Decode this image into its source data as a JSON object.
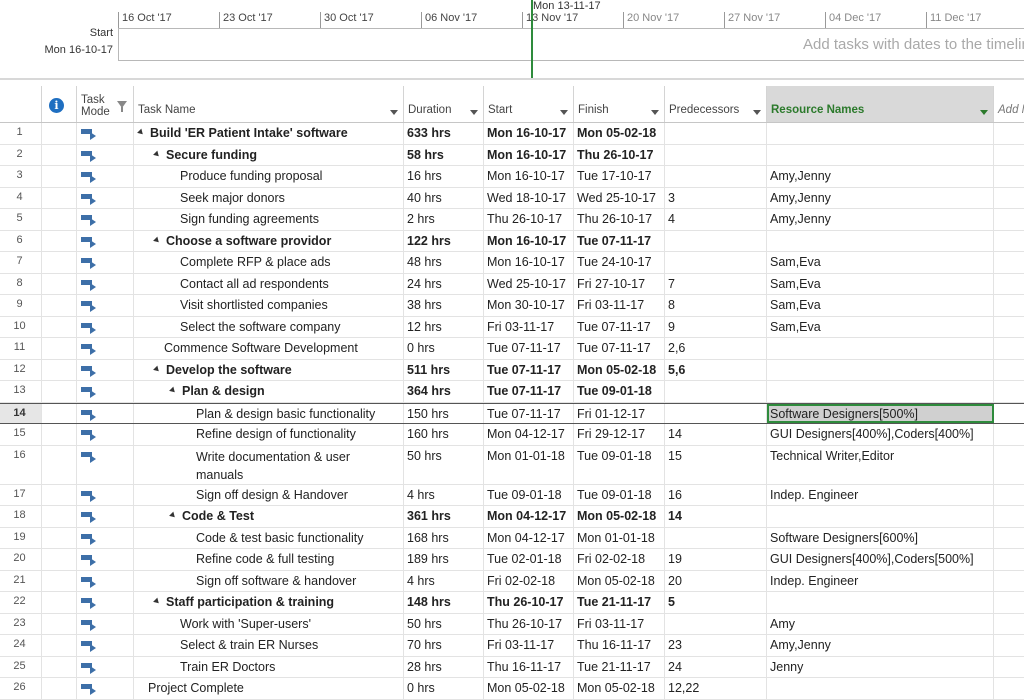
{
  "timeline": {
    "start_label": "Start",
    "start_date": "Mon 16-10-17",
    "today_label": "Mon 13-11-17",
    "hint": "Add tasks with dates to the timeline",
    "ticks": [
      "16 Oct '17",
      "23 Oct '17",
      "30 Oct '17",
      "06 Nov '17",
      "13 Nov '17",
      "20 Nov '17",
      "27 Nov '17",
      "04 Dec '17",
      "11 Dec '17"
    ]
  },
  "columns": {
    "mode": "Task Mode",
    "name": "Task Name",
    "duration": "Duration",
    "start": "Start",
    "finish": "Finish",
    "predecessors": "Predecessors",
    "resources": "Resource Names",
    "add": "Add New Column"
  },
  "rows": [
    {
      "id": "1",
      "name": "Build 'ER Patient Intake' software",
      "dur": "633 hrs",
      "start": "Mon 16-10-17",
      "finish": "Mon 05-02-18",
      "pred": "",
      "res": "",
      "summary": true,
      "level": 0
    },
    {
      "id": "2",
      "name": "Secure funding",
      "dur": "58 hrs",
      "start": "Mon 16-10-17",
      "finish": "Thu 26-10-17",
      "pred": "",
      "res": "",
      "summary": true,
      "level": 1
    },
    {
      "id": "3",
      "name": "Produce funding proposal",
      "dur": "16 hrs",
      "start": "Mon 16-10-17",
      "finish": "Tue 17-10-17",
      "pred": "",
      "res": "Amy,Jenny",
      "summary": false,
      "level": 2
    },
    {
      "id": "4",
      "name": "Seek major donors",
      "dur": "40 hrs",
      "start": "Wed 18-10-17",
      "finish": "Wed 25-10-17",
      "pred": "3",
      "res": "Amy,Jenny",
      "summary": false,
      "level": 2
    },
    {
      "id": "5",
      "name": "Sign funding agreements",
      "dur": "2 hrs",
      "start": "Thu 26-10-17",
      "finish": "Thu 26-10-17",
      "pred": "4",
      "res": "Amy,Jenny",
      "summary": false,
      "level": 2
    },
    {
      "id": "6",
      "name": "Choose a software providor",
      "dur": "122 hrs",
      "start": "Mon 16-10-17",
      "finish": "Tue 07-11-17",
      "pred": "",
      "res": "",
      "summary": true,
      "level": 1
    },
    {
      "id": "7",
      "name": "Complete RFP & place ads",
      "dur": "48 hrs",
      "start": "Mon 16-10-17",
      "finish": "Tue 24-10-17",
      "pred": "",
      "res": "Sam,Eva",
      "summary": false,
      "level": 2
    },
    {
      "id": "8",
      "name": "Contact all ad respondents",
      "dur": "24 hrs",
      "start": "Wed 25-10-17",
      "finish": "Fri 27-10-17",
      "pred": "7",
      "res": "Sam,Eva",
      "summary": false,
      "level": 2
    },
    {
      "id": "9",
      "name": "Visit shortlisted companies",
      "dur": "38 hrs",
      "start": "Mon 30-10-17",
      "finish": "Fri 03-11-17",
      "pred": "8",
      "res": "Sam,Eva",
      "summary": false,
      "level": 2
    },
    {
      "id": "10",
      "name": "Select the software company",
      "dur": "12 hrs",
      "start": "Fri 03-11-17",
      "finish": "Tue 07-11-17",
      "pred": "9",
      "res": "Sam,Eva",
      "summary": false,
      "level": 2
    },
    {
      "id": "11",
      "name": "Commence Software Development",
      "dur": "0 hrs",
      "start": "Tue 07-11-17",
      "finish": "Tue 07-11-17",
      "pred": "2,6",
      "res": "",
      "summary": false,
      "level": 1
    },
    {
      "id": "12",
      "name": "Develop the software",
      "dur": "511 hrs",
      "start": "Tue 07-11-17",
      "finish": "Mon 05-02-18",
      "pred": "5,6",
      "res": "",
      "summary": true,
      "level": 1
    },
    {
      "id": "13",
      "name": "Plan & design",
      "dur": "364 hrs",
      "start": "Tue 07-11-17",
      "finish": "Tue 09-01-18",
      "pred": "",
      "res": "",
      "summary": true,
      "level": 2
    },
    {
      "id": "14",
      "name": "Plan & design basic functionality",
      "dur": "150 hrs",
      "start": "Tue 07-11-17",
      "finish": "Fri 01-12-17",
      "pred": "",
      "res": "Software Designers[500%]",
      "summary": false,
      "level": 3,
      "selected": true
    },
    {
      "id": "15",
      "name": "Refine design of functionality",
      "dur": "160 hrs",
      "start": "Mon 04-12-17",
      "finish": "Fri 29-12-17",
      "pred": "14",
      "res": "GUI Designers[400%],Coders[400%]",
      "summary": false,
      "level": 3
    },
    {
      "id": "16",
      "name": "Write documentation & user manuals",
      "dur": "50 hrs",
      "start": "Mon 01-01-18",
      "finish": "Tue 09-01-18",
      "pred": "15",
      "res": "Technical Writer,Editor",
      "summary": false,
      "level": 3,
      "tall": true
    },
    {
      "id": "17",
      "name": "Sign off design & Handover",
      "dur": "4 hrs",
      "start": "Tue 09-01-18",
      "finish": "Tue 09-01-18",
      "pred": "16",
      "res": "Indep. Engineer",
      "summary": false,
      "level": 3
    },
    {
      "id": "18",
      "name": "Code & Test",
      "dur": "361 hrs",
      "start": "Mon 04-12-17",
      "finish": "Mon 05-02-18",
      "pred": "14",
      "res": "",
      "summary": true,
      "level": 2
    },
    {
      "id": "19",
      "name": "Code & test basic functionality",
      "dur": "168 hrs",
      "start": "Mon 04-12-17",
      "finish": "Mon 01-01-18",
      "pred": "",
      "res": "Software Designers[600%]",
      "summary": false,
      "level": 3
    },
    {
      "id": "20",
      "name": "Refine code & full testing",
      "dur": "189 hrs",
      "start": "Tue 02-01-18",
      "finish": "Fri 02-02-18",
      "pred": "19",
      "res": "GUI Designers[400%],Coders[500%]",
      "summary": false,
      "level": 3
    },
    {
      "id": "21",
      "name": "Sign off software & handover",
      "dur": "4 hrs",
      "start": "Fri 02-02-18",
      "finish": "Mon 05-02-18",
      "pred": "20",
      "res": "Indep. Engineer",
      "summary": false,
      "level": 3
    },
    {
      "id": "22",
      "name": "Staff participation & training",
      "dur": "148 hrs",
      "start": "Thu 26-10-17",
      "finish": "Tue 21-11-17",
      "pred": "5",
      "res": "",
      "summary": true,
      "level": 1
    },
    {
      "id": "23",
      "name": "Work with 'Super-users'",
      "dur": "50 hrs",
      "start": "Thu 26-10-17",
      "finish": "Fri 03-11-17",
      "pred": "",
      "res": "Amy",
      "summary": false,
      "level": 2
    },
    {
      "id": "24",
      "name": "Select & train ER Nurses",
      "dur": "70 hrs",
      "start": "Fri 03-11-17",
      "finish": "Thu 16-11-17",
      "pred": "23",
      "res": "Amy,Jenny",
      "summary": false,
      "level": 2
    },
    {
      "id": "25",
      "name": "Train ER Doctors",
      "dur": "28 hrs",
      "start": "Thu 16-11-17",
      "finish": "Tue 21-11-17",
      "pred": "24",
      "res": "Jenny",
      "summary": false,
      "level": 2
    },
    {
      "id": "26",
      "name": "Project Complete",
      "dur": "0 hrs",
      "start": "Mon 05-02-18",
      "finish": "Mon 05-02-18",
      "pred": "12,22",
      "res": "",
      "summary": false,
      "level": 0
    }
  ]
}
